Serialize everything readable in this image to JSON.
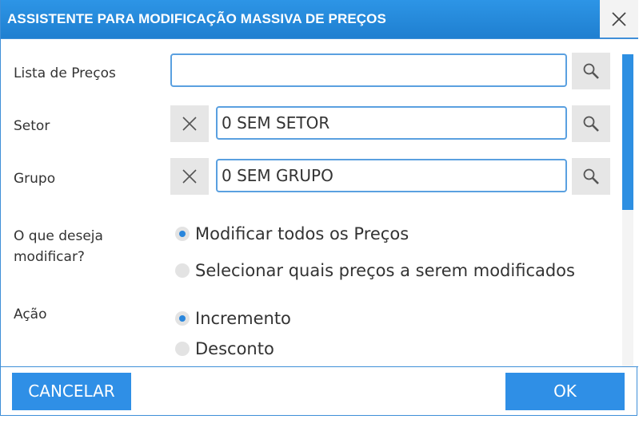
{
  "title": "ASSISTENTE PARA MODIFICAÇÃO MASSIVA DE PREÇOS",
  "fields": {
    "lista_precos": {
      "label": "Lista de Preços",
      "value": ""
    },
    "setor": {
      "label": "Setor",
      "value": "0 SEM SETOR"
    },
    "grupo": {
      "label": "Grupo",
      "value": "0 SEM GRUPO"
    }
  },
  "modificar": {
    "label_line1": "O que deseja",
    "label_line2": "modificar?",
    "options": [
      "Modificar todos os Preços",
      "Selecionar quais preços a serem modificados"
    ],
    "selected": "Modificar todos os Preços"
  },
  "acao": {
    "label": "Ação",
    "options": [
      "Incremento",
      "Desconto"
    ],
    "selected": "Incremento"
  },
  "footer": {
    "cancel_label": "CANCELAR",
    "ok_label": "OK"
  },
  "colors": {
    "accent": "#2f8fe6",
    "title_bar": "#1f7fd0",
    "radio_selected": "#2a86dc"
  }
}
